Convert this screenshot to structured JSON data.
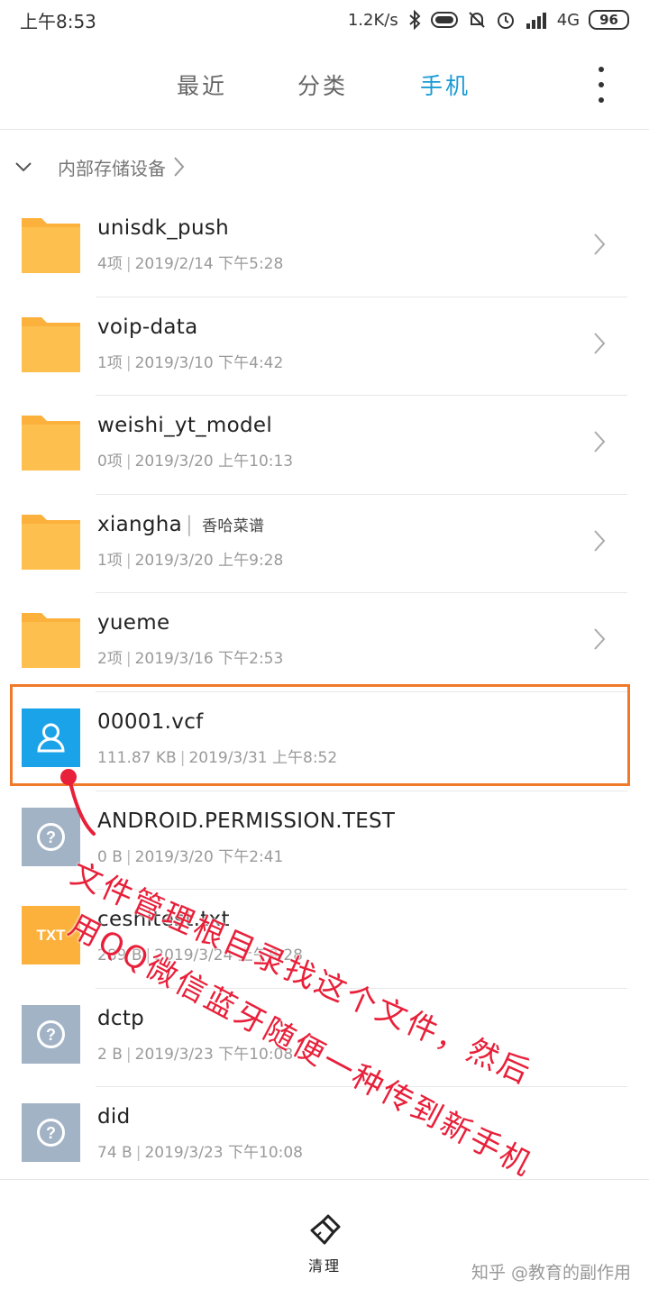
{
  "status_bar": {
    "time": "上午8:53",
    "speed": "1.2K/s",
    "network": "4G",
    "battery": "96"
  },
  "nav": {
    "tabs": [
      {
        "label": "最近",
        "active": false
      },
      {
        "label": "分类",
        "active": false
      },
      {
        "label": "手机",
        "active": true
      }
    ],
    "accent_color": "#1a9ad6"
  },
  "breadcrumb": {
    "label": "内部存储设备"
  },
  "files": [
    {
      "name": "unisdk_push",
      "meta": "4项",
      "date": "2019/2/14 下午5:28",
      "type": "folder"
    },
    {
      "name": "voip-data",
      "meta": "1项",
      "date": "2019/3/10 下午4:42",
      "type": "folder"
    },
    {
      "name": "weishi_yt_model",
      "meta": "0项",
      "date": "2019/3/20 上午10:13",
      "type": "folder"
    },
    {
      "name": "xiangha",
      "tag": "香哈菜谱",
      "meta": "1项",
      "date": "2019/3/20 上午9:28",
      "type": "folder"
    },
    {
      "name": "yueme",
      "meta": "2项",
      "date": "2019/3/16 下午2:53",
      "type": "folder"
    },
    {
      "name": "00001.vcf",
      "meta": "111.87 KB",
      "date": "2019/3/31 上午8:52",
      "type": "contact"
    },
    {
      "name": "ANDROID.PERMISSION.TEST",
      "meta": "0 B",
      "date": "2019/3/20 下午2:41",
      "type": "unknown"
    },
    {
      "name": "ceshitest.txt",
      "meta": "289 B",
      "date": "2019/3/24 上午9:28",
      "type": "txt",
      "icon_label": "TXT"
    },
    {
      "name": "dctp",
      "meta": "2 B",
      "date": "2019/3/23 下午10:08",
      "type": "unknown"
    },
    {
      "name": "did",
      "meta": "74 B",
      "date": "2019/3/23 下午10:08",
      "type": "unknown"
    }
  ],
  "bottom_bar": {
    "clean_label": "清理"
  },
  "watermark": "知乎 @教育的副作用",
  "annotation": {
    "line1": "文件管理根目录找这个文件，然后",
    "line2": "用QQ微信蓝牙随便一种传到新手机",
    "color": "#e8203a"
  }
}
